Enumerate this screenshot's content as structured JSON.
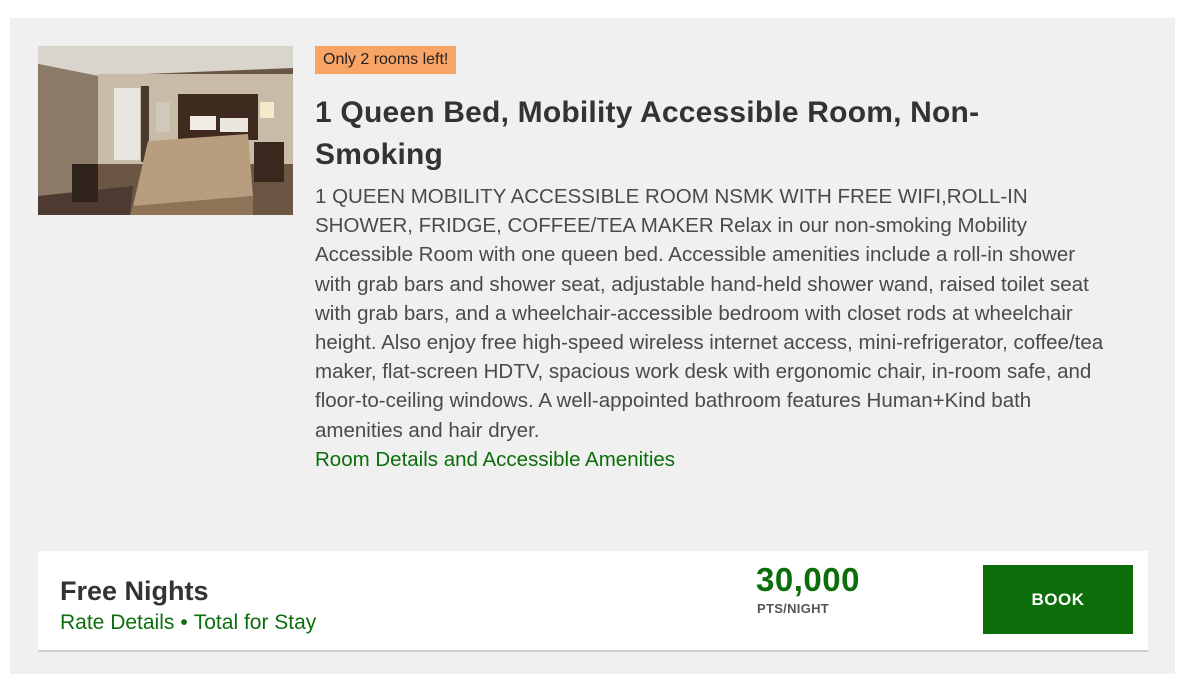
{
  "room": {
    "badge": "Only 2 rooms left!",
    "title": "1 Queen Bed, Mobility Accessible Room, Non-Smoking",
    "description": "1 QUEEN MOBILITY ACCESSIBLE ROOM NSMK WITH FREE WIFI,ROLL-IN SHOWER, FRIDGE, COFFEE/TEA MAKER Relax in our non-smoking Mobility Accessible Room with one queen bed. Accessible amenities include a roll-in shower with grab bars and shower seat, adjustable hand-held shower wand, raised toilet seat with grab bars, and a wheelchair-accessible bedroom with closet rods at wheelchair height. Also enjoy free high-speed wireless internet access, mini-refrigerator, coffee/tea maker, flat-screen HDTV, spacious work desk with ergonomic chair, in-room safe, and floor-to-ceiling windows. A well-appointed bathroom features Human+Kind bath amenities and hair dryer.",
    "details_link": "Room Details and Accessible Amenities"
  },
  "rate": {
    "name": "Free Nights",
    "rate_details_link": "Rate Details",
    "separator": "•",
    "total_link": "Total for Stay",
    "points": "30,000",
    "points_unit": "PTS/NIGHT",
    "book_label": "BOOK"
  },
  "colors": {
    "accent_green": "#0b6e0b",
    "badge_orange": "#f7a465",
    "card_bg": "#f0f0f0"
  }
}
